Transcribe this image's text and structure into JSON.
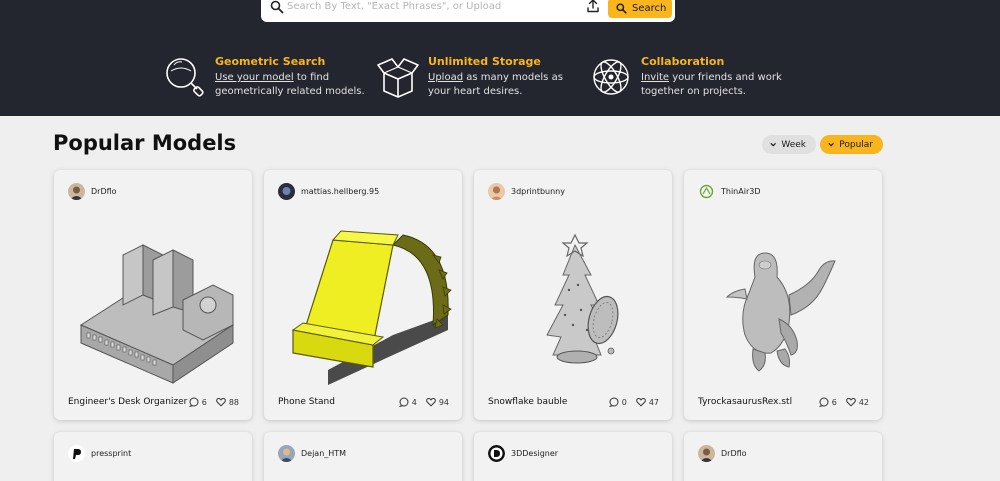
{
  "search": {
    "placeholder": "Search By Text, \"Exact Phrases\", or Upload",
    "button_label": "Search"
  },
  "features": [
    {
      "icon": "magnifier-sphere-icon",
      "title": "Geometric Search",
      "link": "Use your model",
      "rest": " to find geometrically related models."
    },
    {
      "icon": "open-box-icon",
      "title": "Unlimited Storage",
      "link": "Upload",
      "rest": " as many models as your heart desires."
    },
    {
      "icon": "atom-icon",
      "title": "Collaboration",
      "link": "Invite",
      "rest": " your friends and work together on projects."
    }
  ],
  "section": {
    "title": "Popular Models",
    "filter_week": "Week",
    "filter_popular": "Popular"
  },
  "cards": [
    {
      "user": "DrDflo",
      "model": "Engineer's Desk Organizer",
      "comments": "6",
      "likes": "88"
    },
    {
      "user": "mattias.hellberg.95",
      "model": "Phone Stand",
      "comments": "4",
      "likes": "94"
    },
    {
      "user": "3dprintbunny",
      "model": "Snowflake bauble",
      "comments": "0",
      "likes": "47"
    },
    {
      "user": "ThinAir3D",
      "model": "TyrockasaurusRex.stl",
      "comments": "6",
      "likes": "42"
    }
  ],
  "cards_row2": [
    {
      "user": "pressprint"
    },
    {
      "user": "Dejan_HTM"
    },
    {
      "user": "3DDesigner"
    },
    {
      "user": "DrDflo"
    }
  ],
  "colors": {
    "accent": "#f9b51c",
    "header_bg": "#23252f",
    "page_bg": "#efefef"
  }
}
